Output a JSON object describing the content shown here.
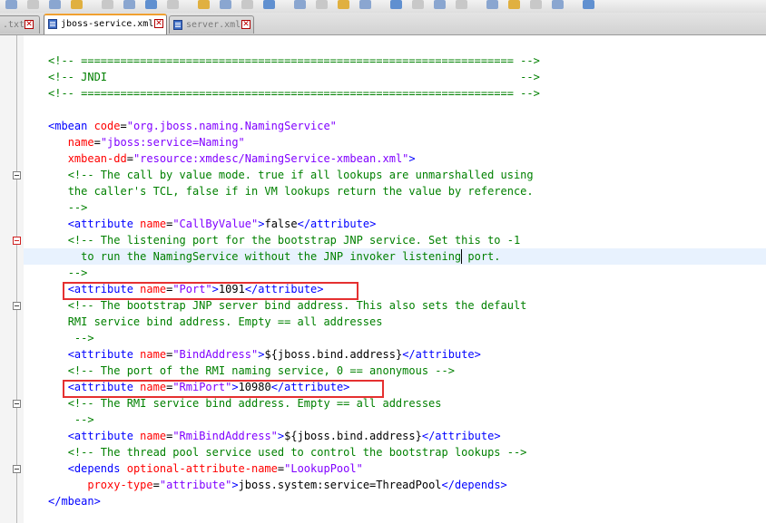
{
  "tabs": [
    {
      "label": ".txt",
      "active": false
    },
    {
      "label": "jboss-service.xml",
      "active": true
    },
    {
      "label": "server.xml",
      "active": false
    }
  ],
  "code_lines": [
    [
      [
        "c",
        "<!-- ================================================================== -->"
      ]
    ],
    [
      [
        "c",
        "<!-- JNDI                                                               -->"
      ]
    ],
    [
      [
        "c",
        "<!-- ================================================================== -->"
      ]
    ],
    [
      [
        "x",
        ""
      ]
    ],
    [
      [
        "t",
        "<mbean "
      ],
      [
        "a",
        "code"
      ],
      [
        "x",
        "="
      ],
      [
        "v",
        "\"org.jboss.naming.NamingService\""
      ]
    ],
    [
      [
        "x",
        "   "
      ],
      [
        "a",
        "name"
      ],
      [
        "x",
        "="
      ],
      [
        "v",
        "\"jboss:service=Naming\""
      ]
    ],
    [
      [
        "x",
        "   "
      ],
      [
        "a",
        "xmbean-dd"
      ],
      [
        "x",
        "="
      ],
      [
        "v",
        "\"resource:xmdesc/NamingService-xmbean.xml\""
      ],
      [
        "t",
        ">"
      ]
    ],
    [
      [
        "x",
        "   "
      ],
      [
        "c",
        "<!-- The call by value mode. true if all lookups are unmarshalled using"
      ]
    ],
    [
      [
        "x",
        "   "
      ],
      [
        "c",
        "the caller's TCL, false if in VM lookups return the value by reference."
      ]
    ],
    [
      [
        "x",
        "   "
      ],
      [
        "c",
        "-->"
      ]
    ],
    [
      [
        "x",
        "   "
      ],
      [
        "t",
        "<attribute "
      ],
      [
        "a",
        "name"
      ],
      [
        "x",
        "="
      ],
      [
        "v",
        "\"CallByValue\""
      ],
      [
        "t",
        ">"
      ],
      [
        "x",
        "false"
      ],
      [
        "t",
        "</attribute>"
      ]
    ],
    [
      [
        "x",
        "   "
      ],
      [
        "c",
        "<!-- The listening port for the bootstrap JNP service. Set this to -1"
      ]
    ],
    [
      [
        "x",
        "     "
      ],
      [
        "c",
        "to run the NamingService without the JNP invoker listening port."
      ]
    ],
    [
      [
        "x",
        "   "
      ],
      [
        "c",
        "-->"
      ]
    ],
    [
      [
        "x",
        "   "
      ],
      [
        "t",
        "<attribute "
      ],
      [
        "a",
        "name"
      ],
      [
        "x",
        "="
      ],
      [
        "v",
        "\"Port\""
      ],
      [
        "t",
        ">"
      ],
      [
        "x",
        "1091"
      ],
      [
        "t",
        "</attribute>"
      ]
    ],
    [
      [
        "x",
        "   "
      ],
      [
        "c",
        "<!-- The bootstrap JNP server bind address. This also sets the default"
      ]
    ],
    [
      [
        "x",
        "   "
      ],
      [
        "c",
        "RMI service bind address. Empty == all addresses"
      ]
    ],
    [
      [
        "x",
        "    "
      ],
      [
        "c",
        "-->"
      ]
    ],
    [
      [
        "x",
        "   "
      ],
      [
        "t",
        "<attribute "
      ],
      [
        "a",
        "name"
      ],
      [
        "x",
        "="
      ],
      [
        "v",
        "\"BindAddress\""
      ],
      [
        "t",
        ">"
      ],
      [
        "x",
        "${jboss.bind.address}"
      ],
      [
        "t",
        "</attribute>"
      ]
    ],
    [
      [
        "x",
        "   "
      ],
      [
        "c",
        "<!-- The port of the RMI naming service, 0 == anonymous -->"
      ]
    ],
    [
      [
        "x",
        "   "
      ],
      [
        "t",
        "<attribute "
      ],
      [
        "a",
        "name"
      ],
      [
        "x",
        "="
      ],
      [
        "v",
        "\"RmiPort\""
      ],
      [
        "t",
        ">"
      ],
      [
        "x",
        "10980"
      ],
      [
        "t",
        "</attribute>"
      ]
    ],
    [
      [
        "x",
        "   "
      ],
      [
        "c",
        "<!-- The RMI service bind address. Empty == all addresses"
      ]
    ],
    [
      [
        "x",
        "    "
      ],
      [
        "c",
        "-->"
      ]
    ],
    [
      [
        "x",
        "   "
      ],
      [
        "t",
        "<attribute "
      ],
      [
        "a",
        "name"
      ],
      [
        "x",
        "="
      ],
      [
        "v",
        "\"RmiBindAddress\""
      ],
      [
        "t",
        ">"
      ],
      [
        "x",
        "${jboss.bind.address}"
      ],
      [
        "t",
        "</attribute>"
      ]
    ],
    [
      [
        "x",
        "   "
      ],
      [
        "c",
        "<!-- The thread pool service used to control the bootstrap lookups -->"
      ]
    ],
    [
      [
        "x",
        "   "
      ],
      [
        "t",
        "<depends "
      ],
      [
        "a",
        "optional-attribute-name"
      ],
      [
        "x",
        "="
      ],
      [
        "v",
        "\"LookupPool\""
      ]
    ],
    [
      [
        "x",
        "      "
      ],
      [
        "a",
        "proxy-type"
      ],
      [
        "x",
        "="
      ],
      [
        "v",
        "\"attribute\""
      ],
      [
        "t",
        ">"
      ],
      [
        "x",
        "jboss.system:service=ThreadPool"
      ],
      [
        "t",
        "</depends>"
      ]
    ],
    [
      [
        "t",
        "</mbean>"
      ]
    ]
  ],
  "highlighted_lines": [
    14,
    20
  ],
  "current_line": 12,
  "fold_markers": [
    {
      "line": 7,
      "marked": false
    },
    {
      "line": 11,
      "marked": true
    },
    {
      "line": 15,
      "marked": false
    },
    {
      "line": 21,
      "marked": false
    },
    {
      "line": 25,
      "marked": false
    }
  ],
  "colors": {
    "comment": "#008000",
    "tag": "#0000ff",
    "attribute": "#ff0000",
    "value": "#8000ff",
    "highlight_box": "#e53030",
    "current_line_bg": "#e8f2fe"
  }
}
